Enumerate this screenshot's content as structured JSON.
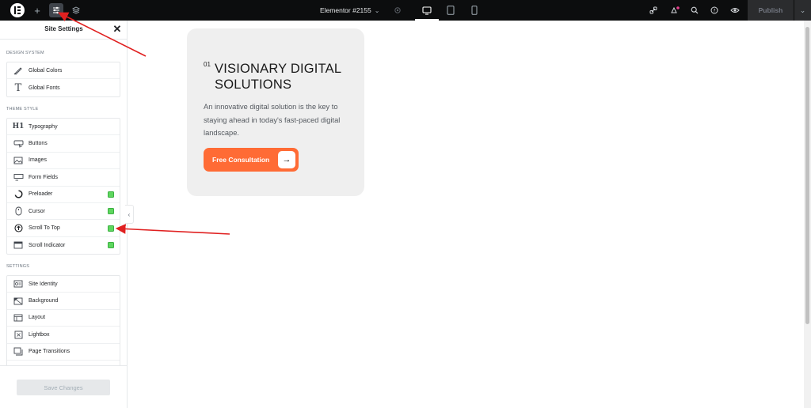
{
  "topbar": {
    "document_title": "Elementor #2155",
    "publish_label": "Publish",
    "icons": [
      "elementor-logo",
      "add-element-icon",
      "site-settings-icon",
      "structure-icon",
      "page-settings-icon",
      "desktop-icon",
      "tablet-icon",
      "mobile-icon",
      "integrations-icon",
      "notifications-icon",
      "search-icon",
      "help-icon",
      "preview-icon"
    ]
  },
  "panel": {
    "title": "Site Settings",
    "sections": [
      {
        "label": "DESIGN SYSTEM",
        "items": [
          {
            "label": "Global Colors",
            "icon": "brush-icon"
          },
          {
            "label": "Global Fonts",
            "icon": "font-icon"
          }
        ]
      },
      {
        "label": "THEME STYLE",
        "items": [
          {
            "label": "Typography",
            "icon": "heading-icon"
          },
          {
            "label": "Buttons",
            "icon": "button-icon"
          },
          {
            "label": "Images",
            "icon": "image-icon"
          },
          {
            "label": "Form Fields",
            "icon": "form-icon"
          },
          {
            "label": "Preloader",
            "icon": "spinner-icon",
            "badge": true
          },
          {
            "label": "Cursor",
            "icon": "mouse-icon",
            "badge": true
          },
          {
            "label": "Scroll To Top",
            "icon": "arrow-up-circle-icon",
            "badge": true
          },
          {
            "label": "Scroll Indicator",
            "icon": "scroll-indicator-icon",
            "badge": true
          }
        ]
      },
      {
        "label": "SETTINGS",
        "items": [
          {
            "label": "Site Identity",
            "icon": "site-identity-icon"
          },
          {
            "label": "Background",
            "icon": "background-icon"
          },
          {
            "label": "Layout",
            "icon": "layout-icon"
          },
          {
            "label": "Lightbox",
            "icon": "lightbox-icon"
          },
          {
            "label": "Page Transitions",
            "icon": "page-transitions-icon"
          }
        ]
      }
    ],
    "save_label": "Save Changes"
  },
  "card": {
    "number": "01",
    "title": "VISIONARY DIGITAL SOLUTIONS",
    "description": "An innovative digital solution is the key to staying ahead in today's fast-paced digital landscape.",
    "cta_label": "Free Consultation"
  },
  "colors": {
    "topbar": "#0c0d0e",
    "accent": "#ff6b35",
    "card_bg": "#efefef",
    "pro_badge": "#5ed65e",
    "annotation_arrow": "#e02020"
  }
}
